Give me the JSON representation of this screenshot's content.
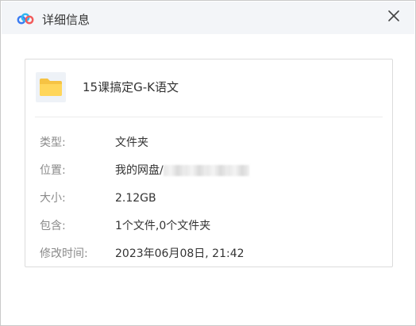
{
  "window": {
    "title": "详细信息",
    "close_icon": "close-icon",
    "logo_icon": "baidu-netdisk-cloud-icon"
  },
  "file": {
    "name": "15课搞定G-K语文",
    "icon": "folder-icon",
    "folder_color": "#ffd65a"
  },
  "details": [
    {
      "label": "类型:",
      "value": "文件夹"
    },
    {
      "label": "位置:",
      "value": "我的网盘/"
    },
    {
      "label": "大小:",
      "value": "2.12GB"
    },
    {
      "label": "包含:",
      "value": "1个文件,0个文件夹"
    },
    {
      "label": "修改时间:",
      "value": "2023年06月08日, 21:42"
    }
  ]
}
